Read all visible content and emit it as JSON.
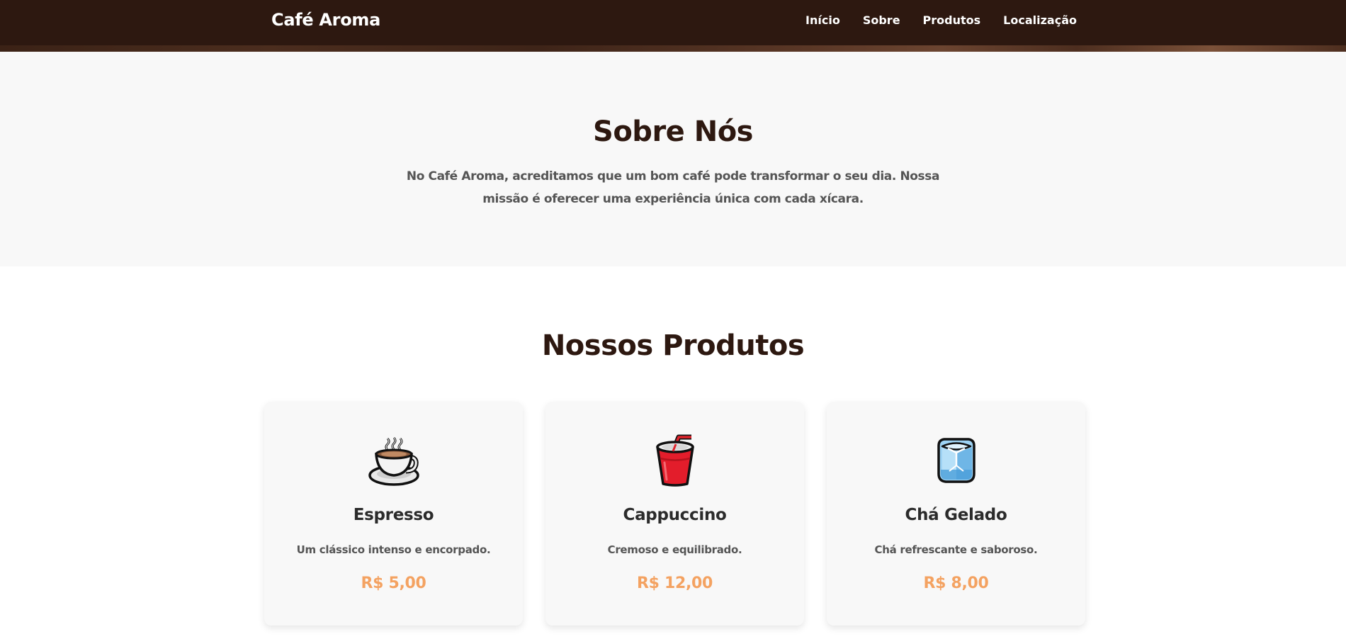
{
  "nav": {
    "brand": "Café Aroma",
    "links": [
      "Início",
      "Sobre",
      "Produtos",
      "Localização"
    ]
  },
  "about": {
    "title": "Sobre Nós",
    "text": "No Café Aroma, acreditamos que um bom café pode transformar o seu dia. Nossa missão é oferecer uma experiência única com cada xícara."
  },
  "products": {
    "title": "Nossos Produtos",
    "items": [
      {
        "icon": "hot-coffee-icon",
        "name": "Espresso",
        "description": "Um clássico intenso e encorpado.",
        "price": "R$ 5,00"
      },
      {
        "icon": "cup-with-straw-icon",
        "name": "Cappuccino",
        "description": "Cremoso e equilibrado.",
        "price": "R$ 12,00"
      },
      {
        "icon": "ice-cube-icon",
        "name": "Chá Gelado",
        "description": "Chá refrescante e saboroso.",
        "price": "R$ 8,00"
      }
    ]
  },
  "colors": {
    "nav_bg": "#2d1810",
    "heading": "#2d1810",
    "price": "#f4a261",
    "section_bg": "#f8f8f8"
  }
}
